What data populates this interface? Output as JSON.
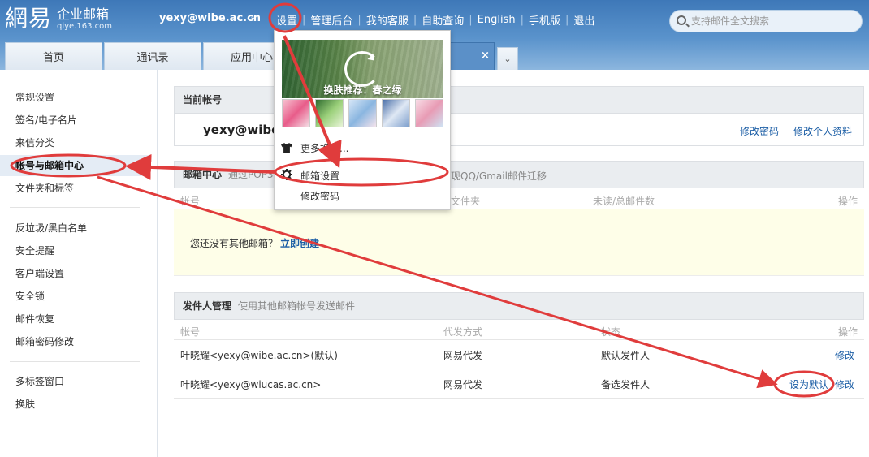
{
  "header": {
    "logo_big": "網易",
    "logo_name": "企业邮箱",
    "logo_domain": "qiye.163.com",
    "user_email": "yexy@wibe.ac.cn",
    "nav": [
      "设置",
      "管理后台",
      "我的客服",
      "自助查询",
      "English",
      "手机版",
      "退出"
    ],
    "search_placeholder": "支持邮件全文搜索"
  },
  "tabs": {
    "items": [
      "首页",
      "通讯录",
      "应用中心"
    ],
    "close_glyph": "×",
    "more_glyph": "⌄"
  },
  "sidebar": {
    "group1": [
      "常规设置",
      "签名/电子名片",
      "来信分类",
      "帐号与邮箱中心",
      "文件夹和标签"
    ],
    "group2": [
      "反垃圾/黑白名单",
      "安全提醒",
      "客户端设置",
      "安全锁",
      "邮件恢复",
      "邮箱密码修改"
    ],
    "group3": [
      "多标签窗口",
      "换肤"
    ]
  },
  "current_account": {
    "title": "当前帐号",
    "name": "yexy@wibe.a",
    "change_password": "修改密码",
    "edit_profile": "修改个人资料"
  },
  "mailbox_center": {
    "title": "邮箱中心",
    "subtitle_left": "通过POP3",
    "subtitle_right": "现QQ/Gmail邮件迁移",
    "columns": [
      "帐号",
      "文件夹",
      "未读/总邮件数",
      "操作"
    ],
    "empty_text": "您还没有其他邮箱？",
    "empty_link": "立即创建"
  },
  "sender_management": {
    "title": "发件人管理",
    "subtitle": "使用其他邮箱帐号发送邮件",
    "columns": [
      "帐号",
      "代发方式",
      "状态",
      "操作"
    ],
    "rows": [
      {
        "account": "叶晓耀<yexy@wibe.ac.cn>(默认)",
        "method": "网易代发",
        "status": "默认发件人",
        "action_modify": "修改"
      },
      {
        "account": "叶晓耀<yexy@wiucas.ac.cn>",
        "method": "网易代发",
        "status": "备选发件人",
        "action_default": "设为默认",
        "action_modify": "修改"
      }
    ]
  },
  "settings_dropdown": {
    "skin_caption": "换肤推荐：春之绿",
    "more_skins": "更多换肤...",
    "mailbox_settings": "邮箱设置",
    "change_password": "修改密码"
  },
  "colors": {
    "accent": "#1d5fa6",
    "header_top": "#3e78b8",
    "annotation_red": "#e03c3c"
  }
}
